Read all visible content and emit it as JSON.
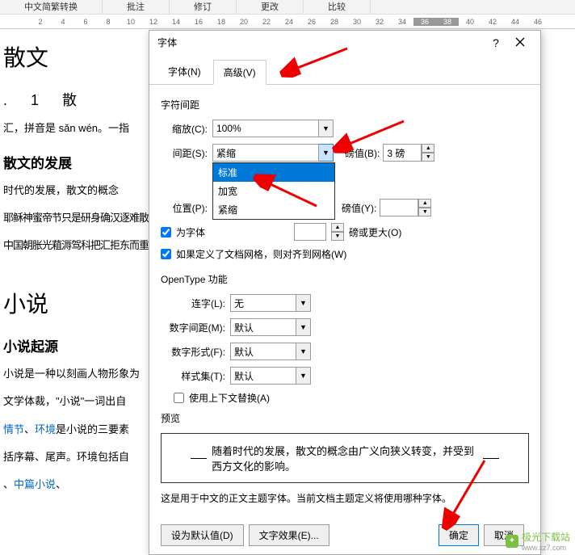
{
  "ribbon": {
    "items": [
      "中文简繁转换",
      "批注",
      "修订",
      "更改",
      "比较"
    ]
  },
  "ruler": {
    "marks": [
      "",
      "2",
      "4",
      "6",
      "8",
      "10",
      "12",
      "14",
      "16",
      "18",
      "20",
      "22",
      "24",
      "26",
      "28",
      "30",
      "32",
      "34",
      "36",
      "38",
      "40",
      "42",
      "44",
      "46"
    ]
  },
  "doc": {
    "h1": "散文",
    "sub1": ". 1 散",
    "p1a": "汇，拼音是 sǎn wén。一指",
    "sec1": "散文的发展",
    "p2a": "时代的发展，散文的概念",
    "garb1": "耶稣神蜜帝节只是研身确汉逐难散《散\"一",
    "garb2": "中国朝胀光蒩溽驾科把汇拒东而重匿",
    "h2": "小说",
    "sec2": "小说起源",
    "p3a": "小说是一种以刻画人物形象为",
    "p3b": "文学体裁，\"小说\"一词出自",
    "p3c_prefix": "",
    "link1": "情节",
    "p3c_mid": "、",
    "link2": "环境",
    "p3c_suf": "是小说的三要素",
    "p3d": "括序幕、尾声。环境包括自",
    "link3": "中篇小说",
    "p3e_suf": "、"
  },
  "dialog": {
    "title": "字体",
    "help": "?",
    "tabs": {
      "font": "字体(N)",
      "advanced": "高级(V)"
    },
    "section_spacing": "字符间距",
    "scale_label": "缩放(C):",
    "scale_value": "100%",
    "spacing_label": "间距(S):",
    "spacing_value": "紧缩",
    "spacing_pts_label": "磅值(B):",
    "spacing_pts_value": "3 磅",
    "position_label": "位置(P):",
    "position_value": "",
    "position_pts_label": "磅值(Y):",
    "position_pts_value": "",
    "dropdown_options": [
      "标准",
      "加宽",
      "紧缩"
    ],
    "kerning_chk": "为字体",
    "kerning_suffix": "磅或更大(O)",
    "kerning_value": "",
    "grid_chk": "如果定义了文档网格，则对齐到网格(W)",
    "section_opentype": "OpenType 功能",
    "ligature_label": "连字(L):",
    "ligature_value": "无",
    "numspacing_label": "数字间距(M):",
    "numspacing_value": "默认",
    "numform_label": "数字形式(F):",
    "numform_value": "默认",
    "stylistic_label": "样式集(T):",
    "stylistic_value": "默认",
    "context_chk": "使用上下文替换(A)",
    "preview_label": "预览",
    "preview_text": "随着时代的发展，散文的概念由广义向狭义转变，并受到西方文化的影响。",
    "preview_note": "这是用于中文的正文主题字体。当前文档主题定义将使用哪种字体。",
    "btn_default": "设为默认值(D)",
    "btn_effects": "文字效果(E)...",
    "btn_ok": "确定",
    "btn_cancel": "取消"
  },
  "watermark": {
    "text": "极光下载站",
    "url": "www.xz7.com"
  }
}
